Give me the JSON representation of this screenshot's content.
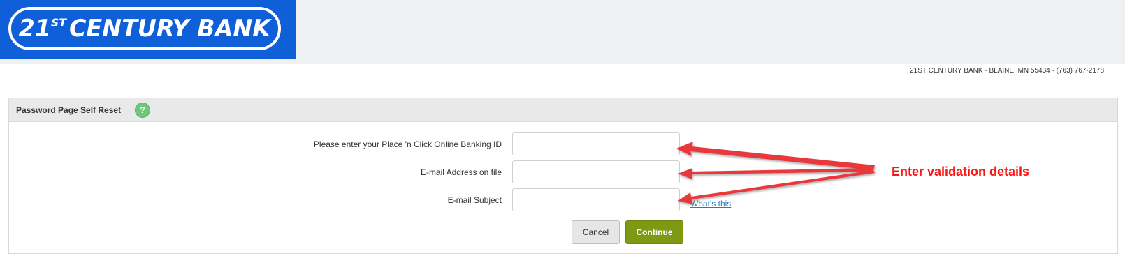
{
  "logo": {
    "main": "21",
    "superscript": "ST",
    "rest": "CENTURY BANK"
  },
  "bank_info": "21ST CENTURY BANK · BLAINE, MN 55434 · (763) 767-2178",
  "panel": {
    "title": "Password Page Self Reset",
    "help_glyph": "?"
  },
  "form": {
    "banking_id_label": "Please enter your Place 'n Click Online Banking ID",
    "banking_id_value": "",
    "email_label": "E-mail Address on file",
    "email_value": "",
    "subject_label": "E-mail Subject",
    "subject_value": "",
    "whats_this": "What's this",
    "cancel_label": "Cancel",
    "continue_label": "Continue"
  },
  "annotation": {
    "text": "Enter validation details",
    "color": "#ff1414"
  },
  "colors": {
    "logo_blue": "#0e5fd8",
    "continue_green": "#7e9a12",
    "help_green": "#6cc97a",
    "link_blue": "#1a7fc1"
  }
}
